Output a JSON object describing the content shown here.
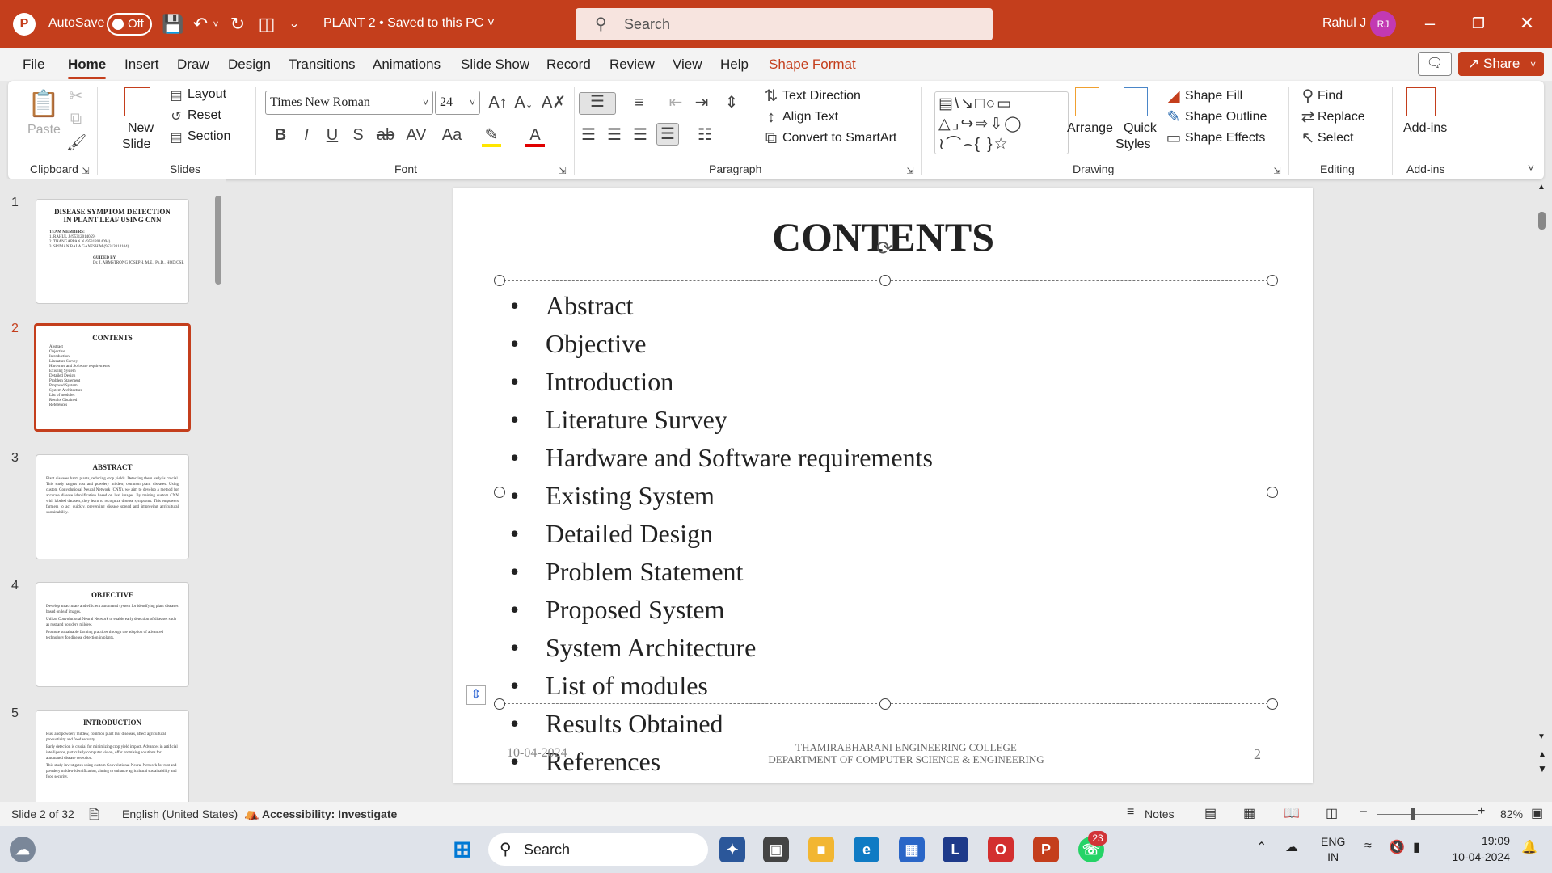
{
  "titlebar": {
    "autosave_label": "AutoSave",
    "autosave_state": "Off",
    "doc_title": "PLANT 2 • Saved to this PC",
    "search_placeholder": "Search",
    "user_name": "Rahul J",
    "user_initials": "RJ"
  },
  "menu": {
    "tabs": [
      "File",
      "Home",
      "Insert",
      "Draw",
      "Design",
      "Transitions",
      "Animations",
      "Slide Show",
      "Record",
      "Review",
      "View",
      "Help",
      "Shape Format"
    ],
    "active": "Home",
    "share_label": "Share"
  },
  "ribbon": {
    "groups": [
      "Clipboard",
      "Slides",
      "Font",
      "Paragraph",
      "Drawing",
      "Editing",
      "Add-ins"
    ],
    "paste": "Paste",
    "new_slide": [
      "New",
      "Slide"
    ],
    "layout": "Layout",
    "reset": "Reset",
    "section": "Section",
    "font_name": "Times New Roman",
    "font_size": "24",
    "text_direction": "Text Direction",
    "align_text": "Align Text",
    "smartart": "Convert to SmartArt",
    "arrange": "Arrange",
    "quick_styles": [
      "Quick",
      "Styles"
    ],
    "shape_fill": "Shape Fill",
    "shape_outline": "Shape Outline",
    "shape_effects": "Shape Effects",
    "find": "Find",
    "replace": "Replace",
    "select": "Select",
    "addins": "Add-ins"
  },
  "thumbnails": {
    "numbers": [
      "1",
      "2",
      "3",
      "4",
      "5"
    ],
    "s1": {
      "title": "DISEASE SYMPTOM DETECTION IN PLANT LEAF USING CNN",
      "team_label": "TEAM MEMBERS:",
      "members": [
        "1. RAHUL J                (95312014059)",
        "2. THANGAPPAN N          (95312014094)",
        "3. SRIMAN BALA GANESH M   (95312014104)"
      ],
      "guided_label": "GUIDED BY",
      "guide": "Dr. J. ARMSTRONG JOSEPH, M.E., Ph.D., HOD/CSE"
    },
    "s2": {
      "title": "CONTENTS",
      "items": [
        "Abstract",
        "Objective",
        "Introduction",
        "Literature Survey",
        "Hardware and Software requirements",
        "Existing System",
        "Detailed Design",
        "Problem Statement",
        "Proposed System",
        "System Architecture",
        "List of modules",
        "Results Obtained",
        "References"
      ]
    },
    "s3": {
      "title": "ABSTRACT",
      "body": "Plant diseases harm plants, reducing crop yields. Detecting them early is crucial. This study targets rust and powdery mildew, common plant diseases. Using custom Convolutional Neural Network (CNN), we aim to develop a method for accurate disease identification based on leaf images. By training custom CNN with labeled datasets, they learn to recognize disease symptoms. This empowers farmers to act quickly, preventing disease spread and improving agricultural sustainability."
    },
    "s4": {
      "title": "OBJECTIVE",
      "items": [
        "Develop an accurate and efficient automated system for identifying plant diseases based on leaf images.",
        "Utilize Convolutional Neural Network to enable early detection of diseases such as rust and powdery mildew.",
        "Promote sustainable farming practices through the adoption of advanced technology for disease detection in plants."
      ]
    },
    "s5": {
      "title": "INTRODUCTION",
      "items": [
        "Rust and powdery mildew, common plant leaf diseases, affect agricultural productivity and food security.",
        "Early detection is crucial for minimizing crop yield impact. Advances in artificial intelligence, particularly computer vision, offer promising solutions for automated disease detection.",
        "This study investigates using custom Convolutional Neural Network for rust and powdery mildew identification, aiming to enhance agricultural sustainability and food security."
      ]
    }
  },
  "slide": {
    "title": "CONTENTS",
    "bullets": [
      "Abstract",
      "Objective",
      "Introduction",
      "Literature Survey",
      "Hardware and Software requirements",
      "Existing System",
      "Detailed Design",
      "Problem Statement",
      "Proposed System",
      "System Architecture",
      "List of modules",
      "Results Obtained",
      "References"
    ],
    "date": "10-04-2024",
    "college_line1": "THAMIRABHARANI ENGINEERING COLLEGE",
    "college_line2": "DEPARTMENT OF COMPUTER SCIENCE & ENGINEERING",
    "page_number": "2"
  },
  "status": {
    "slide_indicator": "Slide 2 of 32",
    "language": "English (United States)",
    "accessibility": "Accessibility: Investigate",
    "notes": "Notes",
    "zoom": "82%"
  },
  "taskbar": {
    "search_placeholder": "Search",
    "whatsapp_badge": "23",
    "lang_top": "ENG",
    "lang_bottom": "IN",
    "time": "19:09",
    "date": "10-04-2024"
  },
  "colors": {
    "accent": "#c43e1c",
    "avatar": "#c239b3"
  }
}
